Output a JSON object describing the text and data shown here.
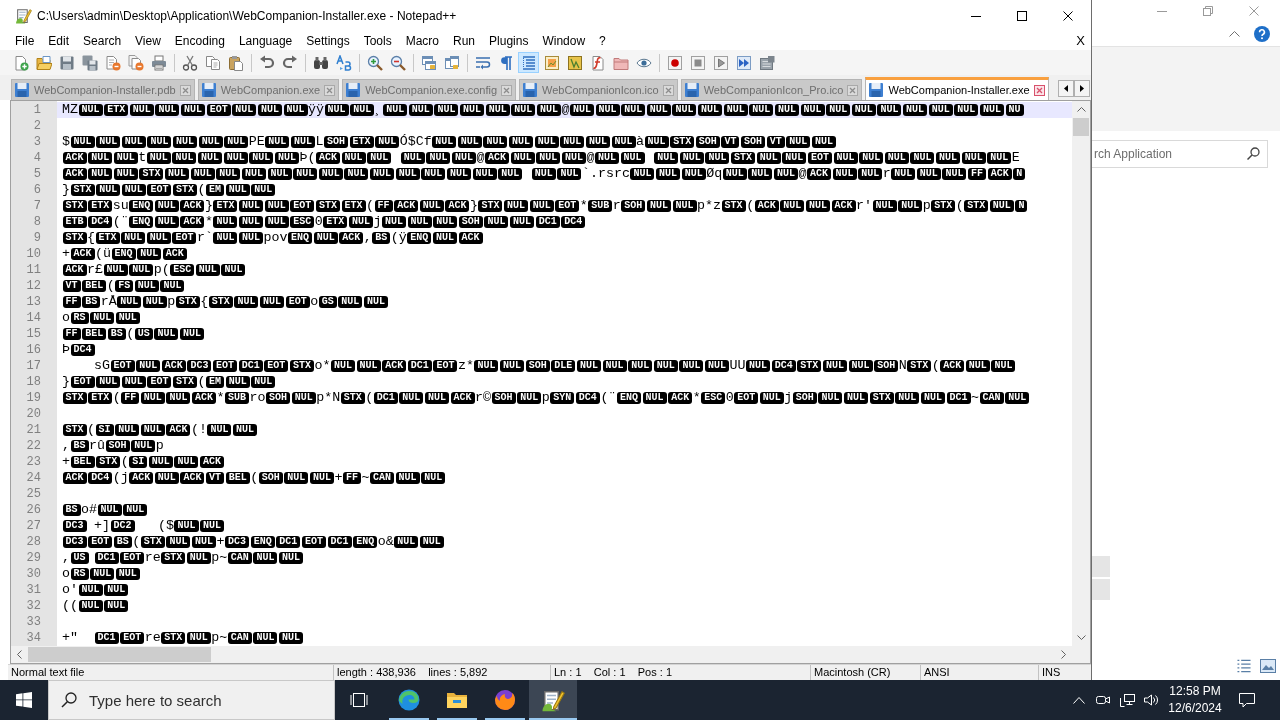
{
  "title_bar": {
    "title": "C:\\Users\\admin\\Desktop\\Application\\WebCompanion-Installer.exe - Notepad++"
  },
  "menu": {
    "items": [
      "File",
      "Edit",
      "Search",
      "View",
      "Encoding",
      "Language",
      "Settings",
      "Tools",
      "Macro",
      "Run",
      "Plugins",
      "Window",
      "?"
    ],
    "close_label": "X"
  },
  "toolbar": [
    {
      "on": false
    },
    {
      "on": false
    },
    {
      "on": false
    },
    {
      "on": false
    },
    {
      "on": false
    },
    {
      "on": false
    },
    {
      "on": false
    },
    {
      "on": false
    },
    {
      "on": false
    },
    {
      "on": false
    },
    {
      "on": false
    },
    {
      "on": false
    },
    {
      "on": false
    },
    {
      "on": false
    },
    {
      "on": false
    },
    {
      "on": false
    },
    {
      "on": false
    },
    {
      "on": false
    },
    {
      "on": false
    },
    {
      "on": false
    },
    {
      "on": true
    },
    {
      "on": false
    },
    {
      "on": false
    },
    {
      "on": false
    },
    {
      "on": false
    },
    {
      "on": false
    },
    {
      "on": false
    },
    {
      "on": false
    },
    {
      "on": false
    },
    {
      "on": false
    },
    {
      "on": false
    }
  ],
  "tabs": [
    {
      "label": "WebCompanion-Installer.pdb",
      "selected": false
    },
    {
      "label": "WebCompanion.exe",
      "selected": false
    },
    {
      "label": "WebCompanion.exe.config",
      "selected": false
    },
    {
      "label": "WebCompanionIcon.ico",
      "selected": false
    },
    {
      "label": "WebCompanionIcon_Pro.ico",
      "selected": false
    },
    {
      "label": "WebCompanion-Installer.exe",
      "selected": true
    }
  ],
  "editor": {
    "lines": [
      {
        "number": "1",
        "current": true,
        "segments": [
          {
            "kind": "text",
            "text": "MZ"
          },
          {
            "kind": "ctrl",
            "text": "NUL ETX NUL NUL NUL EOT NUL NUL NUL"
          },
          {
            "kind": "text",
            "text": "ÿÿ"
          },
          {
            "kind": "ctrl",
            "text": "NUL NUL"
          },
          {
            "kind": "text",
            "text": "¸"
          },
          {
            "kind": "ctrl",
            "text": "NUL NUL NUL NUL NUL NUL NUL"
          },
          {
            "kind": "text",
            "text": "@"
          },
          {
            "kind": "ctrl",
            "text": "NUL NUL NUL NUL NUL NUL NUL NUL NUL NUL NUL NUL NUL NUL NUL NUL NUL NU"
          }
        ]
      },
      {
        "number": "2",
        "current": false
      },
      {
        "number": "3",
        "current": false,
        "segments": [
          {
            "kind": "text",
            "text": "$"
          },
          {
            "kind": "ctrl",
            "text": "NUL NUL NUL NUL NUL NUL NUL"
          },
          {
            "kind": "text",
            "text": "PE"
          },
          {
            "kind": "ctrl",
            "text": "NUL NUL"
          },
          {
            "kind": "text",
            "text": "L"
          },
          {
            "kind": "ctrl",
            "text": "SOH ETX NUL"
          },
          {
            "kind": "text",
            "text": "Ó$Cf"
          },
          {
            "kind": "ctrl",
            "text": "NUL NUL NUL NUL NUL NUL NUL NUL"
          },
          {
            "kind": "text",
            "text": "à"
          },
          {
            "kind": "ctrl",
            "text": "NUL STX SOH VT SOH VT NUL NUL"
          }
        ]
      },
      {
        "number": "4",
        "current": false,
        "segments": [
          {
            "kind": "ctrl",
            "text": "ACK NUL NUL"
          },
          {
            "kind": "text",
            "text": "t"
          },
          {
            "kind": "ctrl",
            "text": "NUL NUL NUL NUL NUL NUL"
          },
          {
            "kind": "text",
            "text": "Þ("
          },
          {
            "kind": "ctrl",
            "text": "ACK NUL NUL  NUL NUL NUL"
          },
          {
            "kind": "text",
            "text": "@"
          },
          {
            "kind": "ctrl",
            "text": "ACK NUL NUL NUL"
          },
          {
            "kind": "text",
            "text": "@"
          },
          {
            "kind": "ctrl",
            "text": "NUL NUL  NUL NUL NUL STX NUL NUL EOT NUL NUL NUL NUL NUL NUL NUL"
          },
          {
            "kind": "text",
            "text": "E"
          }
        ]
      },
      {
        "number": "5",
        "current": false,
        "segments": [
          {
            "kind": "ctrl",
            "text": "ACK NUL NUL STX NUL NUL NUL NUL NUL NUL NUL NUL NUL NUL NUL NUL NUL NUL  NUL NUL"
          },
          {
            "kind": "text",
            "text": "`.rsrc"
          },
          {
            "kind": "ctrl",
            "text": "NUL NUL NUL"
          },
          {
            "kind": "text",
            "text": "Øq"
          },
          {
            "kind": "ctrl",
            "text": "NUL NUL NUL"
          },
          {
            "kind": "text",
            "text": "@"
          },
          {
            "kind": "ctrl",
            "text": "ACK NUL NUL"
          },
          {
            "kind": "text",
            "text": "r"
          },
          {
            "kind": "ctrl",
            "text": "NUL NUL NUL FF ACK N"
          }
        ]
      },
      {
        "number": "6",
        "current": false,
        "segments": [
          {
            "kind": "text",
            "text": "}"
          },
          {
            "kind": "ctrl",
            "text": "STX NUL NUL EOT STX"
          },
          {
            "kind": "text",
            "text": "("
          },
          {
            "kind": "ctrl",
            "text": "EM NUL NUL"
          }
        ]
      },
      {
        "number": "7",
        "current": false,
        "segments": [
          {
            "kind": "ctrl",
            "text": "STX ETX"
          },
          {
            "kind": "text",
            "text": "su"
          },
          {
            "kind": "ctrl",
            "text": "ENQ NUL ACK"
          },
          {
            "kind": "text",
            "text": "}"
          },
          {
            "kind": "ctrl",
            "text": "ETX NUL NUL EOT STX ETX"
          },
          {
            "kind": "text",
            "text": "("
          },
          {
            "kind": "ctrl",
            "text": "FF ACK NUL ACK"
          },
          {
            "kind": "text",
            "text": "}"
          },
          {
            "kind": "ctrl",
            "text": "STX NUL NUL EOT"
          },
          {
            "kind": "text",
            "text": "*"
          },
          {
            "kind": "ctrl",
            "text": "SUB"
          },
          {
            "kind": "text",
            "text": "r"
          },
          {
            "kind": "ctrl",
            "text": "SOH NUL NUL"
          },
          {
            "kind": "text",
            "text": "p*z"
          },
          {
            "kind": "ctrl",
            "text": "STX"
          },
          {
            "kind": "text",
            "text": "("
          },
          {
            "kind": "ctrl",
            "text": "ACK NUL NUL ACK"
          },
          {
            "kind": "text",
            "text": "r'"
          },
          {
            "kind": "ctrl",
            "text": "NUL NUL"
          },
          {
            "kind": "text",
            "text": "p"
          },
          {
            "kind": "ctrl",
            "text": "STX"
          },
          {
            "kind": "text",
            "text": "("
          },
          {
            "kind": "ctrl",
            "text": "STX NUL N"
          }
        ]
      },
      {
        "number": "8",
        "current": false,
        "segments": [
          {
            "kind": "ctrl",
            "text": "ETB DC4"
          },
          {
            "kind": "text",
            "text": "(¨"
          },
          {
            "kind": "ctrl",
            "text": "ENQ NUL ACK"
          },
          {
            "kind": "text",
            "text": "*"
          },
          {
            "kind": "ctrl",
            "text": "NUL NUL NUL ESC"
          },
          {
            "kind": "text",
            "text": "0"
          },
          {
            "kind": "ctrl",
            "text": "ETX NUL"
          },
          {
            "kind": "text",
            "text": "j"
          },
          {
            "kind": "ctrl",
            "text": "NUL NUL NUL SOH NUL NUL DC1 DC4"
          }
        ]
      },
      {
        "number": "9",
        "current": false,
        "segments": [
          {
            "kind": "ctrl",
            "text": "STX"
          },
          {
            "kind": "text",
            "text": "{"
          },
          {
            "kind": "ctrl",
            "text": "ETX NUL NUL EOT"
          },
          {
            "kind": "text",
            "text": "r`"
          },
          {
            "kind": "ctrl",
            "text": "NUL NUL"
          },
          {
            "kind": "text",
            "text": "pov"
          },
          {
            "kind": "ctrl",
            "text": "ENQ NUL ACK"
          },
          {
            "kind": "text",
            "text": ","
          },
          {
            "kind": "ctrl",
            "text": "BS"
          },
          {
            "kind": "text",
            "text": "(ÿ"
          },
          {
            "kind": "ctrl",
            "text": "ENQ NUL ACK"
          }
        ]
      },
      {
        "number": "10",
        "current": false,
        "segments": [
          {
            "kind": "text",
            "text": "+"
          },
          {
            "kind": "ctrl",
            "text": "ACK"
          },
          {
            "kind": "text",
            "text": "(ü"
          },
          {
            "kind": "ctrl",
            "text": "ENQ NUL ACK"
          }
        ]
      },
      {
        "number": "11",
        "current": false,
        "segments": [
          {
            "kind": "ctrl",
            "text": "ACK"
          },
          {
            "kind": "text",
            "text": "r£"
          },
          {
            "kind": "ctrl",
            "text": "NUL NUL"
          },
          {
            "kind": "text",
            "text": "p("
          },
          {
            "kind": "ctrl",
            "text": "ESC NUL NUL"
          }
        ]
      },
      {
        "number": "12",
        "current": false,
        "segments": [
          {
            "kind": "ctrl",
            "text": "VT BEL"
          },
          {
            "kind": "text",
            "text": "("
          },
          {
            "kind": "ctrl",
            "text": "FS NUL NUL"
          }
        ]
      },
      {
        "number": "13",
        "current": false,
        "segments": [
          {
            "kind": "ctrl",
            "text": "FF BS"
          },
          {
            "kind": "text",
            "text": "rÅ"
          },
          {
            "kind": "ctrl",
            "text": "NUL NUL"
          },
          {
            "kind": "text",
            "text": "p"
          },
          {
            "kind": "ctrl",
            "text": "STX"
          },
          {
            "kind": "text",
            "text": "{"
          },
          {
            "kind": "ctrl",
            "text": "STX NUL NUL EOT"
          },
          {
            "kind": "text",
            "text": "o"
          },
          {
            "kind": "ctrl",
            "text": "GS NUL NUL"
          }
        ]
      },
      {
        "number": "14",
        "current": false,
        "segments": [
          {
            "kind": "text",
            "text": "o"
          },
          {
            "kind": "ctrl",
            "text": "RS NUL NUL"
          }
        ]
      },
      {
        "number": "15",
        "current": false,
        "segments": [
          {
            "kind": "ctrl",
            "text": "FF BEL BS"
          },
          {
            "kind": "text",
            "text": "("
          },
          {
            "kind": "ctrl",
            "text": "US NUL NUL"
          }
        ]
      },
      {
        "number": "16",
        "current": false,
        "segments": [
          {
            "kind": "text",
            "text": "Þ"
          },
          {
            "kind": "ctrl",
            "text": "DC4"
          }
        ]
      },
      {
        "number": "17",
        "current": false,
        "segments": [
          {
            "kind": "text",
            "text": "\tsG"
          },
          {
            "kind": "ctrl",
            "text": "EOT NUL ACK DC3 EOT DC1 EOT STX"
          },
          {
            "kind": "text",
            "text": "o*"
          },
          {
            "kind": "ctrl",
            "text": "NUL NUL ACK DC1 EOT"
          },
          {
            "kind": "text",
            "text": "z*"
          },
          {
            "kind": "ctrl",
            "text": "NUL NUL SOH DLE NUL NUL NUL NUL NUL NUL"
          },
          {
            "kind": "text",
            "text": "UU"
          },
          {
            "kind": "ctrl",
            "text": "NUL DC4 STX NUL NUL SOH"
          },
          {
            "kind": "text",
            "text": "N"
          },
          {
            "kind": "ctrl",
            "text": "STX"
          },
          {
            "kind": "text",
            "text": "("
          },
          {
            "kind": "ctrl",
            "text": "ACK NUL NUL"
          }
        ]
      },
      {
        "number": "18",
        "current": false,
        "segments": [
          {
            "kind": "text",
            "text": "}"
          },
          {
            "kind": "ctrl",
            "text": "EOT NUL NUL EOT STX"
          },
          {
            "kind": "text",
            "text": "("
          },
          {
            "kind": "ctrl",
            "text": "EM NUL NUL"
          }
        ]
      },
      {
        "number": "19",
        "current": false,
        "segments": [
          {
            "kind": "ctrl",
            "text": "STX ETX"
          },
          {
            "kind": "text",
            "text": "("
          },
          {
            "kind": "ctrl",
            "text": "FF NUL NUL ACK"
          },
          {
            "kind": "text",
            "text": "*"
          },
          {
            "kind": "ctrl",
            "text": "SUB"
          },
          {
            "kind": "text",
            "text": "ro"
          },
          {
            "kind": "ctrl",
            "text": "SOH NUL"
          },
          {
            "kind": "text",
            "text": "p*N"
          },
          {
            "kind": "ctrl",
            "text": "STX"
          },
          {
            "kind": "text",
            "text": "("
          },
          {
            "kind": "ctrl",
            "text": "DC1 NUL NUL ACK"
          },
          {
            "kind": "text",
            "text": "r©"
          },
          {
            "kind": "ctrl",
            "text": "SOH NUL"
          },
          {
            "kind": "text",
            "text": "p"
          },
          {
            "kind": "ctrl",
            "text": "SYN DC4"
          },
          {
            "kind": "text",
            "text": "(¨"
          },
          {
            "kind": "ctrl",
            "text": "ENQ NUL ACK"
          },
          {
            "kind": "text",
            "text": "*"
          },
          {
            "kind": "ctrl",
            "text": "ESC"
          },
          {
            "kind": "text",
            "text": "0"
          },
          {
            "kind": "ctrl",
            "text": "EOT NUL"
          },
          {
            "kind": "text",
            "text": "j"
          },
          {
            "kind": "ctrl",
            "text": "SOH NUL NUL STX NUL NUL DC1"
          },
          {
            "kind": "text",
            "text": "~"
          },
          {
            "kind": "ctrl",
            "text": "CAN NUL"
          }
        ]
      },
      {
        "number": "20",
        "current": false
      },
      {
        "number": "21",
        "current": false,
        "segments": [
          {
            "kind": "ctrl",
            "text": "STX"
          },
          {
            "kind": "text",
            "text": "("
          },
          {
            "kind": "ctrl",
            "text": "SI NUL NUL ACK"
          },
          {
            "kind": "text",
            "text": "(!"
          },
          {
            "kind": "ctrl",
            "text": "NUL NUL"
          }
        ]
      },
      {
        "number": "22",
        "current": false,
        "segments": [
          {
            "kind": "text",
            "text": ","
          },
          {
            "kind": "ctrl",
            "text": "BS"
          },
          {
            "kind": "text",
            "text": "rû"
          },
          {
            "kind": "ctrl",
            "text": "SOH NUL"
          },
          {
            "kind": "text",
            "text": "p"
          }
        ]
      },
      {
        "number": "23",
        "current": false,
        "segments": [
          {
            "kind": "text",
            "text": "+"
          },
          {
            "kind": "ctrl",
            "text": "BEL STX"
          },
          {
            "kind": "text",
            "text": "("
          },
          {
            "kind": "ctrl",
            "text": "SI NUL NUL ACK"
          }
        ]
      },
      {
        "number": "24",
        "current": false,
        "segments": [
          {
            "kind": "ctrl",
            "text": "ACK DC4"
          },
          {
            "kind": "text",
            "text": "(j"
          },
          {
            "kind": "ctrl",
            "text": "ACK NUL ACK VT BEL"
          },
          {
            "kind": "text",
            "text": "("
          },
          {
            "kind": "ctrl",
            "text": "SOH NUL NUL"
          },
          {
            "kind": "text",
            "text": "+"
          },
          {
            "kind": "ctrl",
            "text": "FF"
          },
          {
            "kind": "text",
            "text": "~"
          },
          {
            "kind": "ctrl",
            "text": "CAN NUL NUL"
          }
        ]
      },
      {
        "number": "25",
        "current": false
      },
      {
        "number": "26",
        "current": false,
        "segments": [
          {
            "kind": "ctrl",
            "text": "BS"
          },
          {
            "kind": "text",
            "text": "o#"
          },
          {
            "kind": "ctrl",
            "text": "NUL NUL"
          }
        ]
      },
      {
        "number": "27",
        "current": false,
        "segments": [
          {
            "kind": "ctrl",
            "text": "DC3"
          },
          {
            "kind": "text",
            "text": "\t+]"
          },
          {
            "kind": "ctrl",
            "text": "DC2"
          },
          {
            "kind": "text",
            "text": "\t($"
          },
          {
            "kind": "ctrl",
            "text": "NUL NUL"
          }
        ]
      },
      {
        "number": "28",
        "current": false,
        "segments": [
          {
            "kind": "ctrl",
            "text": "DC3 EOT BS"
          },
          {
            "kind": "text",
            "text": "("
          },
          {
            "kind": "ctrl",
            "text": "STX NUL NUL"
          },
          {
            "kind": "text",
            "text": "+"
          },
          {
            "kind": "ctrl",
            "text": "DC3 ENQ DC1 EOT DC1 ENQ"
          },
          {
            "kind": "text",
            "text": "o&"
          },
          {
            "kind": "ctrl",
            "text": "NUL NUL"
          }
        ]
      },
      {
        "number": "29",
        "current": false,
        "segments": [
          {
            "kind": "text",
            "text": ","
          },
          {
            "kind": "ctrl",
            "text": "US\tDC1 EOT"
          },
          {
            "kind": "text",
            "text": "re"
          },
          {
            "kind": "ctrl",
            "text": "STX NUL"
          },
          {
            "kind": "text",
            "text": "p~"
          },
          {
            "kind": "ctrl",
            "text": "CAN NUL NUL"
          }
        ]
      },
      {
        "number": "30",
        "current": false,
        "segments": [
          {
            "kind": "text",
            "text": "o"
          },
          {
            "kind": "ctrl",
            "text": "RS NUL NUL"
          }
        ]
      },
      {
        "number": "31",
        "current": false,
        "segments": [
          {
            "kind": "text",
            "text": "o'"
          },
          {
            "kind": "ctrl",
            "text": "NUL NUL"
          }
        ]
      },
      {
        "number": "32",
        "current": false,
        "segments": [
          {
            "kind": "text",
            "text": "(("
          },
          {
            "kind": "ctrl",
            "text": "NUL NUL"
          }
        ]
      },
      {
        "number": "33",
        "current": false
      },
      {
        "number": "34",
        "current": false,
        "segments": [
          {
            "kind": "text",
            "text": "+\"\t"
          },
          {
            "kind": "ctrl",
            "text": "DC1 EOT"
          },
          {
            "kind": "text",
            "text": "re"
          },
          {
            "kind": "ctrl",
            "text": "STX NUL"
          },
          {
            "kind": "text",
            "text": "p~"
          },
          {
            "kind": "ctrl",
            "text": "CAN NUL NUL"
          }
        ]
      }
    ]
  },
  "status_bar": [
    "Normal text file",
    "length : 438,936    lines : 5,892",
    "Ln : 1    Col : 1    Pos : 1",
    "Macintosh (CR)",
    "ANSI",
    "INS"
  ],
  "background_window": {
    "search": {
      "placeholder": "rch Application"
    }
  },
  "taskbar": {
    "search": {
      "placeholder": "Type here to search"
    },
    "apps": [
      {
        "running": true,
        "active": false
      },
      {
        "running": true,
        "active": false
      },
      {
        "running": true,
        "active": false
      },
      {
        "running": true,
        "active": true
      }
    ],
    "clock": {
      "time": "12:58 PM",
      "date": "12/6/2024"
    }
  }
}
